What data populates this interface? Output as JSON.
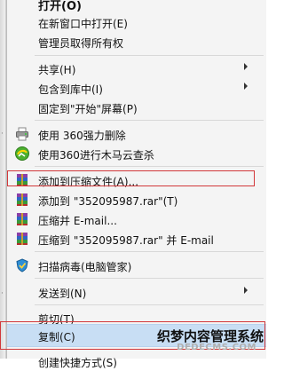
{
  "menu": {
    "open": "打开(O)",
    "open_new_window": "在新窗口中打开(E)",
    "take_ownership": "管理员取得所有权",
    "share": "共享(H)",
    "include_in_library": "包含到库中(I)",
    "pin_to_start": "固定到\"开始\"屏幕(P)",
    "force_delete_360": "使用 360强力删除",
    "cloud_scan_360": "使用360进行木马云查杀",
    "add_to_archive": "添加到压缩文件(A)...",
    "add_to_rar": "添加到 \"352095987.rar\"(T)",
    "compress_email": "压缩并 E-mail...",
    "compress_rar_email": "压缩到 \"352095987.rar\" 并 E-mail",
    "scan_virus": "扫描病毒(电脑管家)",
    "send_to": "发送到(N)",
    "cut": "剪切(T)",
    "copy": "复制(C)",
    "create_shortcut": "创建快捷方式(S)"
  },
  "watermark": {
    "cn": "织梦内容管理系统",
    "en": "DEDECMS.COM"
  },
  "colors": {
    "highlight": "#c8def4",
    "annotation_red": "#d2383a",
    "menu_bg": "#f4f4f4"
  },
  "icons": {
    "force_delete_360": "printer-icon",
    "cloud_scan_360": "shield-360-icon",
    "winrar": "winrar-books-icon",
    "scan_virus": "tencent-shield-icon"
  }
}
